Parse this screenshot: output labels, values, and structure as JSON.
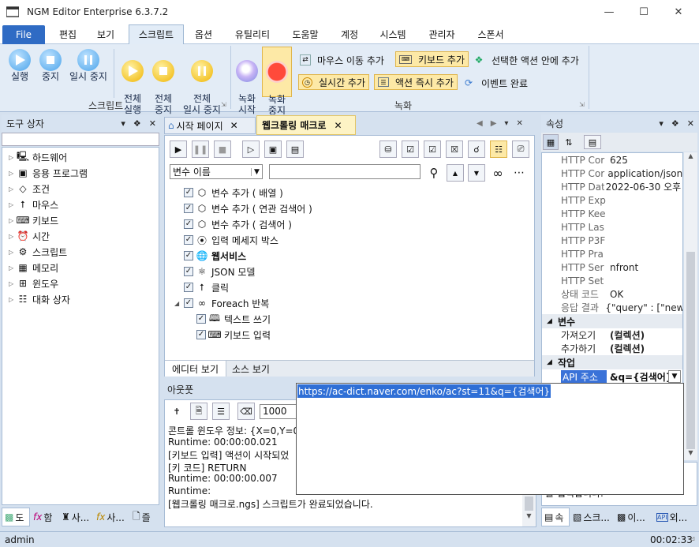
{
  "window": {
    "title": "NGM Editor   Enterprise 6.3.7.2"
  },
  "menu": {
    "file": "File",
    "items": [
      "편집",
      "보기",
      "스크립트",
      "옵션",
      "유틸리티",
      "도움말",
      "계정",
      "시스템",
      "관리자",
      "스폰서"
    ]
  },
  "ribbon": {
    "script_group": {
      "label": "스크립트",
      "run": "실행",
      "stop": "중지",
      "pause": "일시 중지",
      "run_all": "전체\n실행",
      "stop_all": "전체\n중지",
      "pause_all": "전체\n일시 중지"
    },
    "record_group": {
      "label": "녹화",
      "record_start": "녹화\n시작",
      "record_stop": "녹화\n중지",
      "mouse_move": "마우스 이동 추가",
      "keyboard_add": "키보드 추가",
      "insert_in_action": "선택한 액션 안에 추가",
      "realtime_add": "실시간 추가",
      "action_add": "액션 즉시 추가",
      "event_done": "이벤트 완료"
    }
  },
  "toolbox": {
    "title": "도구 상자",
    "items": [
      {
        "label": "하드웨어",
        "icon": "computer-icon"
      },
      {
        "label": "응용 프로그램",
        "icon": "app-icon"
      },
      {
        "label": "조건",
        "icon": "condition-icon"
      },
      {
        "label": "마우스",
        "icon": "mouse-icon"
      },
      {
        "label": "키보드",
        "icon": "keyboard-icon"
      },
      {
        "label": "시간",
        "icon": "clock-icon"
      },
      {
        "label": "스크립트",
        "icon": "script-icon"
      },
      {
        "label": "메모리",
        "icon": "memory-icon"
      },
      {
        "label": "윈도우",
        "icon": "windows-icon"
      },
      {
        "label": "대화 상자",
        "icon": "dialog-icon"
      }
    ],
    "bottom_tabs": [
      "도",
      "함",
      "사...",
      "사...",
      "즐"
    ]
  },
  "editor": {
    "tabs": [
      "시작 페이지",
      "웹크롤링 매크로"
    ],
    "variable_dropdown": "변수 이름",
    "nodes": [
      {
        "label": "변수 추가 ( 배열 )",
        "indent": 0,
        "bold": false
      },
      {
        "label": "변수 추가 ( 연관 검색어 )",
        "indent": 0,
        "bold": false
      },
      {
        "label": "변수 추가 ( 검색어 )",
        "indent": 0,
        "bold": false
      },
      {
        "label": "입력 메세지 박스",
        "indent": 0,
        "bold": false
      },
      {
        "label": "웹서비스",
        "indent": 0,
        "bold": true
      },
      {
        "label": "JSON 모델",
        "indent": 0,
        "bold": false
      },
      {
        "label": "클릭",
        "indent": 0,
        "bold": false
      },
      {
        "label": "Foreach 반복",
        "indent": 0,
        "bold": false,
        "expander": true
      },
      {
        "label": "텍스트 쓰기",
        "indent": 1,
        "bold": false
      },
      {
        "label": "키보드 입력",
        "indent": 1,
        "bold": false
      }
    ],
    "bottom_tabs": [
      "에디터 보기",
      "소스 보기"
    ]
  },
  "output": {
    "title": "아웃풋",
    "count": "1000",
    "lines": [
      "콘트롤 윈도우 정보: {X=0,Y=0,",
      "Runtime: 00:00:00.021",
      "[키보드 입력] 액션이 시작되었",
      "[키 코드] RETURN",
      "Runtime: 00:00:00.007",
      "Runtime:",
      "[웹크롤링 매크로.ngs] 스크립트가 완료되었습니다."
    ]
  },
  "properties": {
    "title": "속성",
    "rows": [
      {
        "k": "HTTP Cor",
        "v": "625"
      },
      {
        "k": "HTTP Cor",
        "v": "application/json;"
      },
      {
        "k": "HTTP Dat",
        "v": "2022-06-30 오후 2"
      },
      {
        "k": "HTTP Exp",
        "v": ""
      },
      {
        "k": "HTTP Kee",
        "v": ""
      },
      {
        "k": "HTTP Las",
        "v": ""
      },
      {
        "k": "HTTP P3F",
        "v": ""
      },
      {
        "k": "HTTP Pra",
        "v": ""
      },
      {
        "k": "HTTP Ser",
        "v": "nfront"
      },
      {
        "k": "HTTP Set",
        "v": ""
      },
      {
        "k": "상태 코드",
        "v": "OK"
      },
      {
        "k": "응답 결과",
        "v": "{\"query\" : [\"newg"
      }
    ],
    "cat_variable": "변수",
    "var_rows": [
      {
        "k": "가져오기",
        "v": "(컬렉션)"
      },
      {
        "k": "추가하기",
        "v": "(컬렉션)"
      }
    ],
    "cat_task": "작업",
    "api_key": "API 주소",
    "api_value": "&q={검색어}",
    "hint_text": "를 입력합니다.",
    "bottom_tabs": [
      "속",
      "스크...",
      "이...",
      "외..."
    ]
  },
  "dropdown_edit": {
    "text": "https://ac-dict.naver.com/enko/ac?st=11&q={검색어}"
  },
  "status": {
    "user": "admin",
    "time": "00:02:33"
  }
}
